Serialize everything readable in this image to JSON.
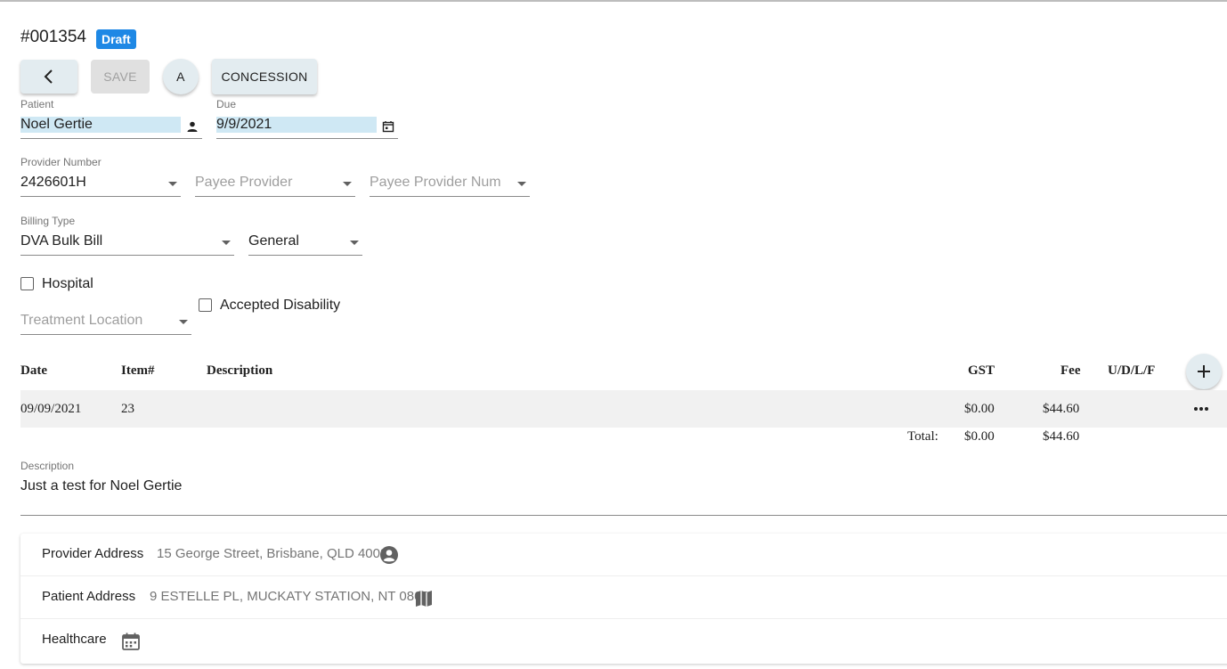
{
  "header": {
    "invoice_number": "#001354",
    "status_badge": "Draft"
  },
  "toolbar": {
    "save_label": "SAVE",
    "a_label": "A",
    "concession_label": "CONCESSION"
  },
  "patient": {
    "label": "Patient",
    "value": "Noel Gertie"
  },
  "due": {
    "label": "Due",
    "value": "9/9/2021"
  },
  "provider_number": {
    "label": "Provider Number",
    "value": "2426601H"
  },
  "payee_provider": {
    "placeholder": "Payee Provider"
  },
  "payee_provider_num": {
    "placeholder": "Payee Provider Num"
  },
  "billing_type": {
    "label": "Billing Type",
    "value": "DVA Bulk Bill"
  },
  "billing_category": {
    "value": "General"
  },
  "hospital": {
    "label": "Hospital",
    "checked": false
  },
  "treatment_location": {
    "placeholder": "Treatment Location"
  },
  "accepted_disability": {
    "label": "Accepted Disability",
    "checked": false
  },
  "table": {
    "headers": {
      "date": "Date",
      "item": "Item#",
      "description": "Description",
      "gst": "GST",
      "fee": "Fee",
      "udlf": "U/D/L/F"
    },
    "rows": [
      {
        "date": "09/09/2021",
        "item": "23",
        "description": "",
        "gst": "$0.00",
        "fee": "$44.60",
        "udlf": ""
      }
    ],
    "totals": {
      "label": "Total:",
      "gst": "$0.00",
      "fee": "$44.60"
    }
  },
  "description": {
    "label": "Description",
    "value": "Just a test for Noel Gertie"
  },
  "addresses": {
    "provider": {
      "label": "Provider Address",
      "value": "15 George Street, Brisbane, QLD 4003"
    },
    "patient": {
      "label": "Patient Address",
      "value": "9 ESTELLE PL, MUCKATY STATION, NT 0862"
    },
    "healthcare": {
      "label": "Healthcare"
    }
  },
  "colors": {
    "accent_badge": "#1e88e5",
    "highlight": "#cfe8f4",
    "button_bg": "#e3ecf0"
  },
  "icons": [
    "chevron-left-icon",
    "person-icon",
    "calendar-icon",
    "caret-down-icon",
    "plus-icon",
    "more-horizontal-icon",
    "account-circle-icon",
    "map-icon"
  ]
}
